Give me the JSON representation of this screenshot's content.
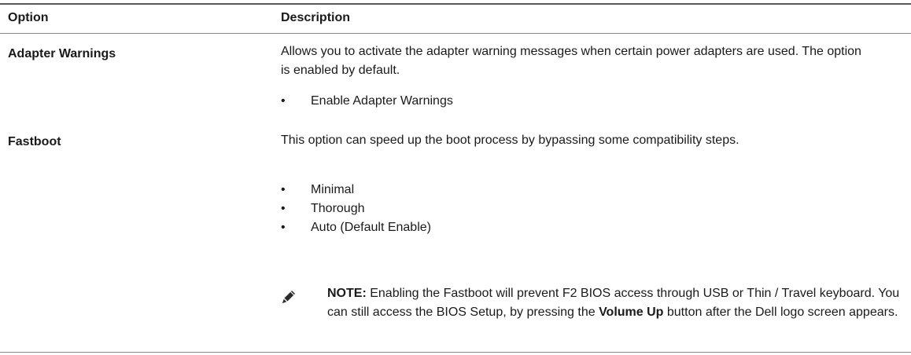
{
  "header": {
    "option": "Option",
    "description": "Description"
  },
  "rows": [
    {
      "option": "Adapter Warnings",
      "description": "Allows you to activate the adapter warning messages when certain power adapters are used. The option is enabled by default.",
      "bullets": [
        "Enable Adapter Warnings"
      ]
    },
    {
      "option": "Fastboot",
      "description": "This option can speed up the boot process by bypassing some compatibility steps.",
      "bullets": [
        "Minimal",
        "Thorough",
        "Auto (Default Enable)"
      ]
    }
  ],
  "note": {
    "label": "NOTE:",
    "text_1": " Enabling the Fastboot will prevent F2 BIOS access through USB or Thin / Travel keyboard. You can still access the BIOS Setup, by pressing the ",
    "bold_key": "Volume Up",
    "text_2": " button after the Dell logo screen appears.",
    "icon": "pencil-note-icon"
  },
  "bullet_glyph": "•"
}
